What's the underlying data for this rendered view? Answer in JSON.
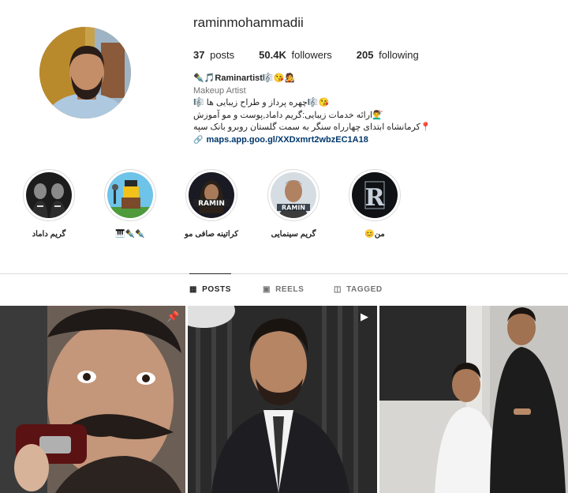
{
  "profile": {
    "username": "raminmohammadii",
    "stats": {
      "posts_count": "37",
      "posts_label": "posts",
      "followers_count": "50.4K",
      "followers_label": "followers",
      "following_count": "205",
      "following_label": "following"
    },
    "bio": {
      "name_line": "✒️🎵Raminartist🎼😘🧑‍🎤",
      "category": "Makeup Artist",
      "line1": "😘🎼چهره پرداز و طراح زیبایی ها 🎼",
      "line2": "💇‍♂️ارائه خدمات زیبایی:گریم داماد,پوست و مو آموزش",
      "line3": "📍کرمانشاه ابتدای چهارراه سنگر به سمت گلستان روبرو بانک سپه",
      "link": "maps.app.goo.gl/XXDxmrt2wbzEC1A18",
      "link_icon": "link-icon"
    }
  },
  "highlights": [
    {
      "label": "گریم داماد",
      "icon": "groom-highlight"
    },
    {
      "label": "🎹✒️✒️",
      "icon": "lego-highlight"
    },
    {
      "label": "کراتینه صافی مو",
      "icon": "keratin-highlight"
    },
    {
      "label": "گریم سینمایی",
      "icon": "cinema-highlight"
    },
    {
      "label": "من😊",
      "icon": "r-logo-highlight"
    }
  ],
  "tabs": [
    {
      "label": "POSTS",
      "icon": "grid-icon",
      "active": true
    },
    {
      "label": "REELS",
      "icon": "reels-icon",
      "active": false
    },
    {
      "label": "TAGGED",
      "icon": "tagged-icon",
      "active": false
    }
  ],
  "posts": [
    {
      "badge": "pin-icon"
    },
    {
      "badge": "reel-icon"
    },
    {
      "badge": ""
    }
  ],
  "colors": {
    "text_primary": "#262626",
    "text_secondary": "#737373",
    "link": "#00376b",
    "divider": "#dbdbdb"
  }
}
